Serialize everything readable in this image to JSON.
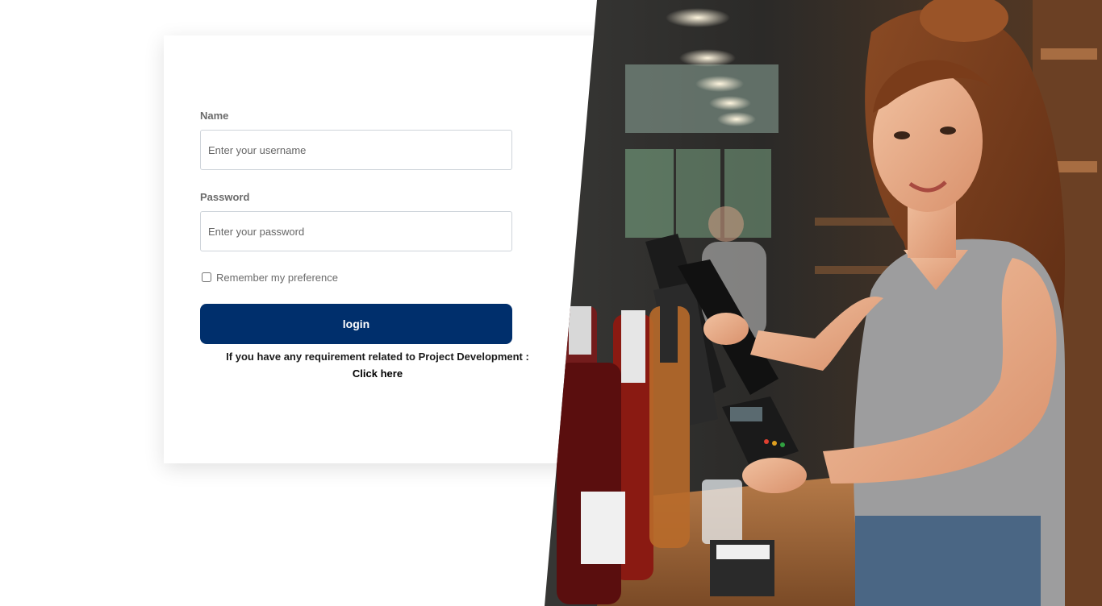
{
  "form": {
    "name_label": "Name",
    "name_placeholder": "Enter your username",
    "name_value": "",
    "password_label": "Password",
    "password_placeholder": "Enter your password",
    "password_value": "",
    "remember_label": "Remember my preference",
    "remember_checked": false,
    "login_label": "login"
  },
  "requirement": {
    "text": "If you have any requirement related to Project Development :",
    "link_label": "Click here"
  },
  "hero_image": {
    "alt": "cashier-at-liquor-store-counter"
  },
  "colors": {
    "button": "#002f6c",
    "label": "#6b6b6b"
  }
}
